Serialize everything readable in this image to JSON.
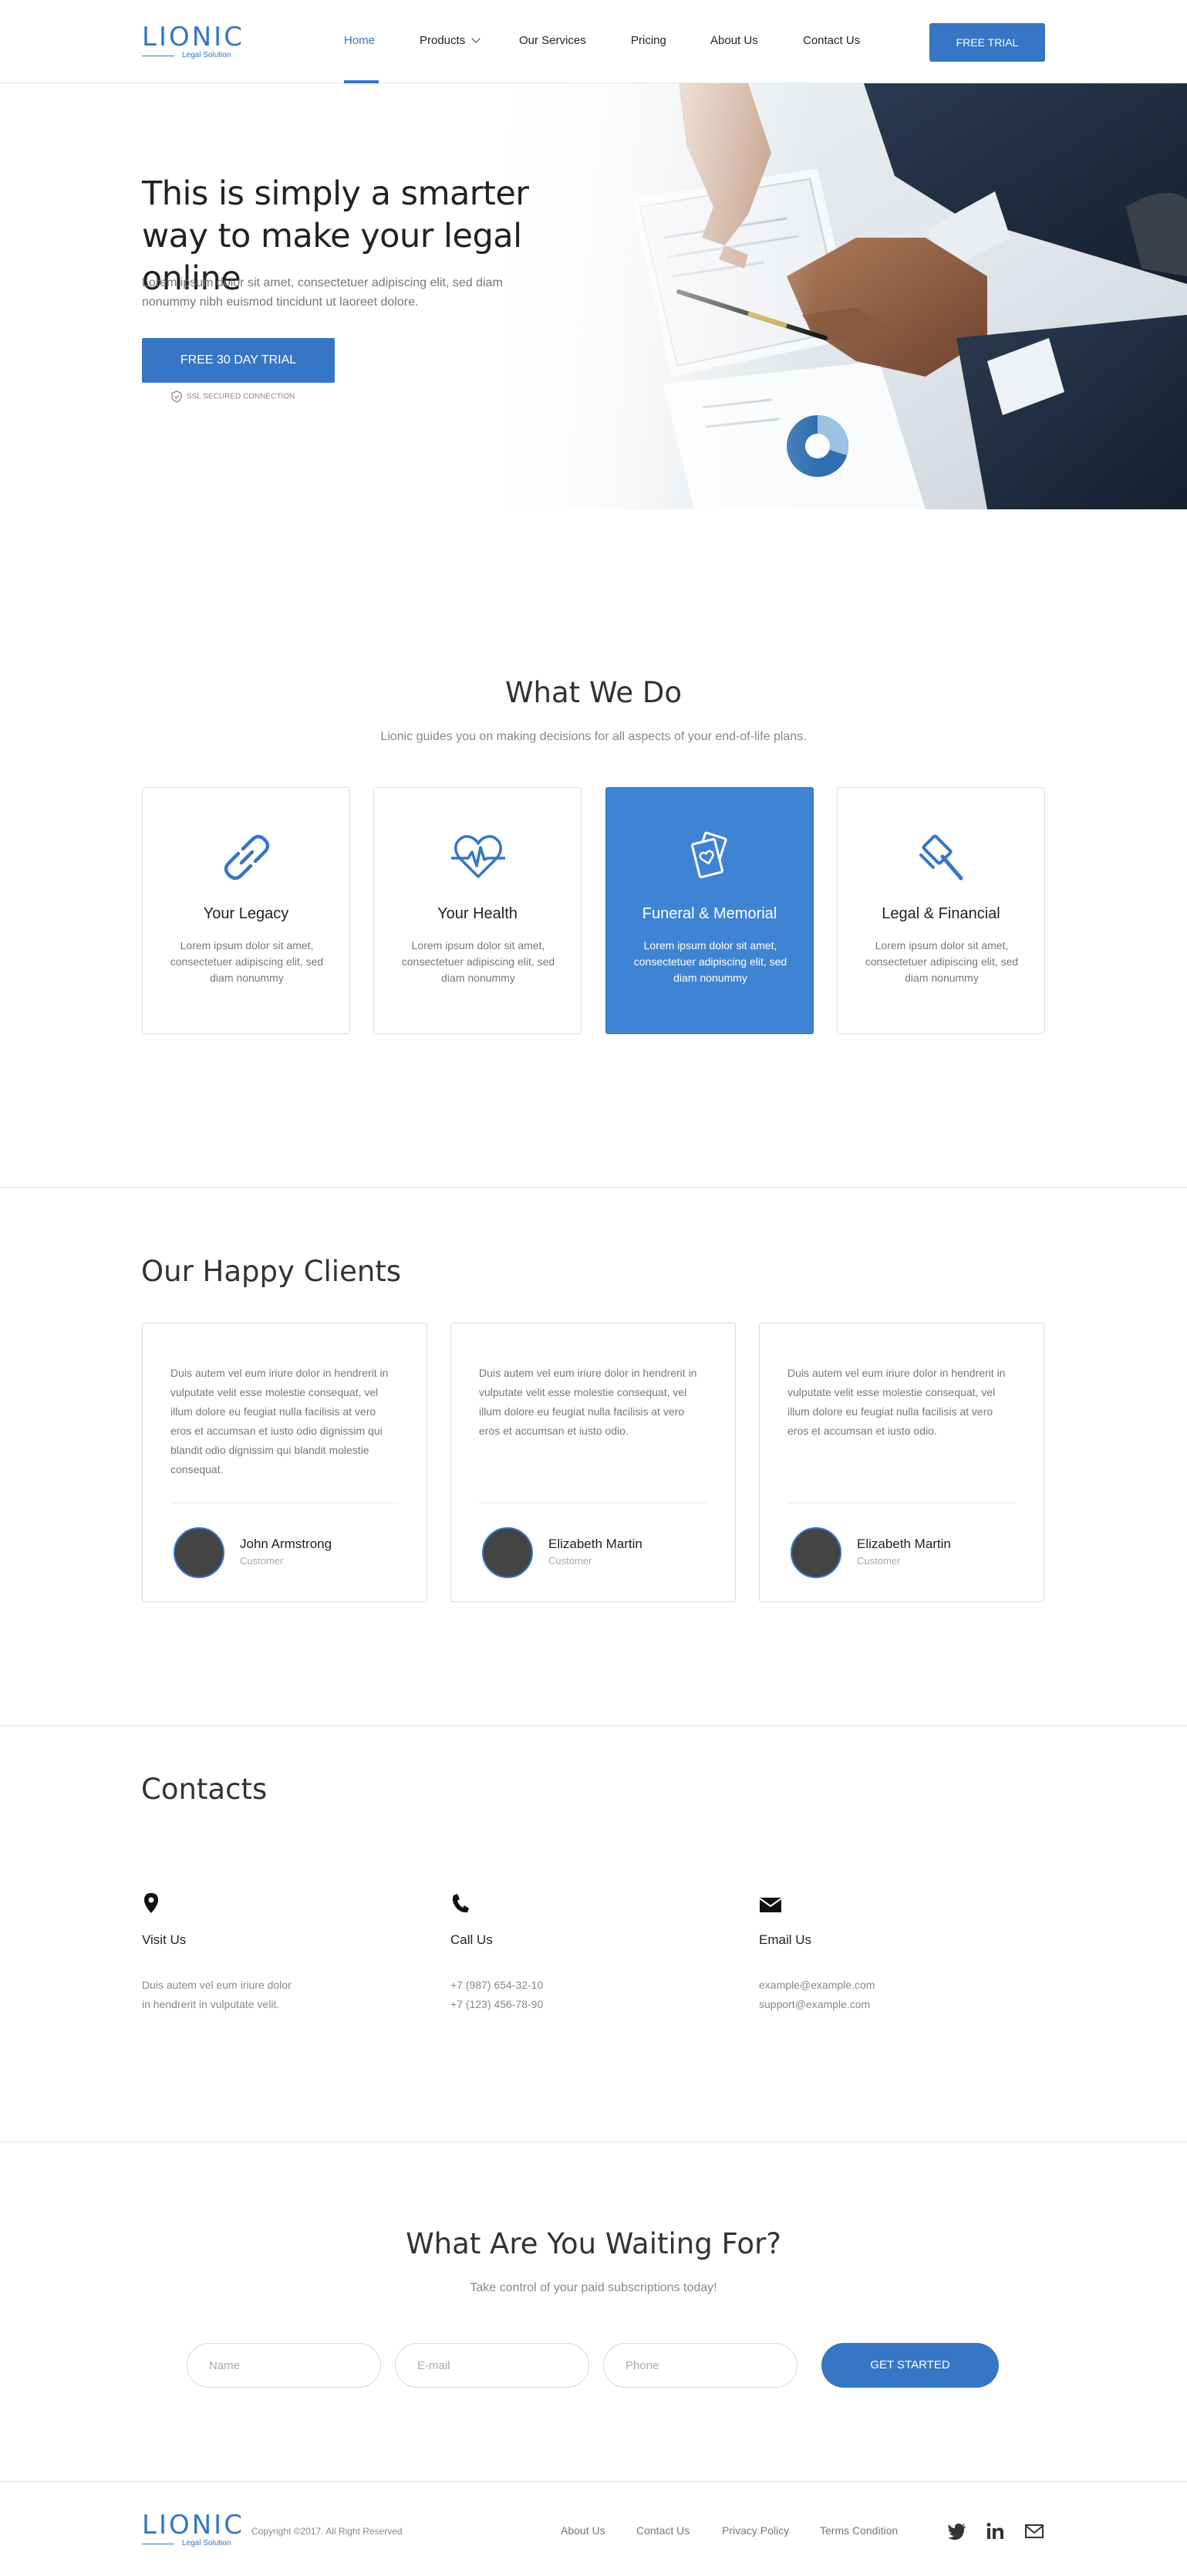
{
  "brand": {
    "name": "LIONIC",
    "tagline": "Legal Solution",
    "color": "#3776c4"
  },
  "nav": {
    "items": [
      {
        "label": "Home",
        "active": true
      },
      {
        "label": "Products"
      },
      {
        "label": "Our Services"
      },
      {
        "label": "Pricing"
      },
      {
        "label": "About Us"
      },
      {
        "label": "Contact Us"
      }
    ],
    "cta": "FREE TRIAL"
  },
  "hero": {
    "title": "This is simply a smarter way to make your legal online",
    "text": "Lorem ipsum dolor sit amet, consectetuer adipiscing elit, sed diam nonummy nibh euismod tincidunt ut laoreet dolore.",
    "button": "FREE 30 DAY TRIAL",
    "ssl": "SSL SECURED CONNECTION"
  },
  "services": {
    "title": "What We Do",
    "subtitle": "Lionic guides you on making decisions for all aspects of your end-of-life plans.",
    "cards": [
      {
        "icon": "infinity-icon",
        "title": "Your Legacy",
        "text": "Lorem ipsum dolor sit amet, consectetuer adipiscing elit, sed diam nonummy"
      },
      {
        "icon": "heartbeat-icon",
        "title": "Your Health",
        "text": "Lorem ipsum dolor sit amet, consectetuer adipiscing elit, sed diam nonummy"
      },
      {
        "icon": "photo-cards-icon",
        "title": "Funeral & Memorial",
        "text": "Lorem ipsum dolor sit amet, consectetuer adipiscing elit, sed diam nonummy",
        "highlight": true
      },
      {
        "icon": "gavel-icon",
        "title": "Legal & Financial",
        "text": "Lorem ipsum dolor sit amet, consectetuer adipiscing elit, sed diam nonummy"
      }
    ]
  },
  "clients": {
    "title": "Our Happy Clients",
    "items": [
      {
        "quote": "Duis autem vel eum iriure dolor in hendrerit in vulputate velit esse molestie consequat, vel illum dolore eu feugiat nulla facilisis at vero eros et accumsan et iusto odio dignissim qui blandit odio dignissim qui blandit molestie consequat.",
        "name": "John Armstrong",
        "role": "Customer"
      },
      {
        "quote": "Duis autem vel eum iriure dolor in hendrerit in vulputate velit esse molestie consequat, vel illum dolore eu feugiat nulla facilisis at vero eros et accumsan et iusto odio.",
        "name": "Elizabeth Martin",
        "role": "Customer"
      },
      {
        "quote": "Duis autem vel eum iriure dolor in hendrerit in vulputate velit esse molestie consequat, vel illum dolore eu feugiat nulla facilisis at vero eros et accumsan et iusto odio.",
        "name": "Elizabeth Martin",
        "role": "Customer"
      }
    ]
  },
  "contacts": {
    "title": "Contacts",
    "visit": {
      "icon": "map-pin-icon",
      "title": "Visit Us",
      "lines": [
        "Duis autem vel eum iriure dolor",
        "in hendrerit in vulputate velit."
      ]
    },
    "call": {
      "icon": "phone-icon",
      "title": "Call Us",
      "lines": [
        "+7 (987) 654-32-10",
        "+7 (123) 456-78-90"
      ]
    },
    "email": {
      "icon": "envelope-icon",
      "title": "Email Us",
      "lines": [
        "example@example.com",
        "support@example.com"
      ]
    }
  },
  "cta": {
    "title": "What Are You Waiting For?",
    "subtitle": "Take control of your paid subscriptions today!",
    "name_placeholder": "Name",
    "email_placeholder": "E-mail",
    "phone_placeholder": "Phone",
    "button": "GET STARTED"
  },
  "footer": {
    "copyright": "Copyright ©2017. All Right Reserved",
    "links": [
      "About Us",
      "Contact Us",
      "Privacy Policy",
      "Terms Condition"
    ],
    "social": [
      "twitter-icon",
      "linkedin-icon",
      "mail-icon"
    ]
  }
}
